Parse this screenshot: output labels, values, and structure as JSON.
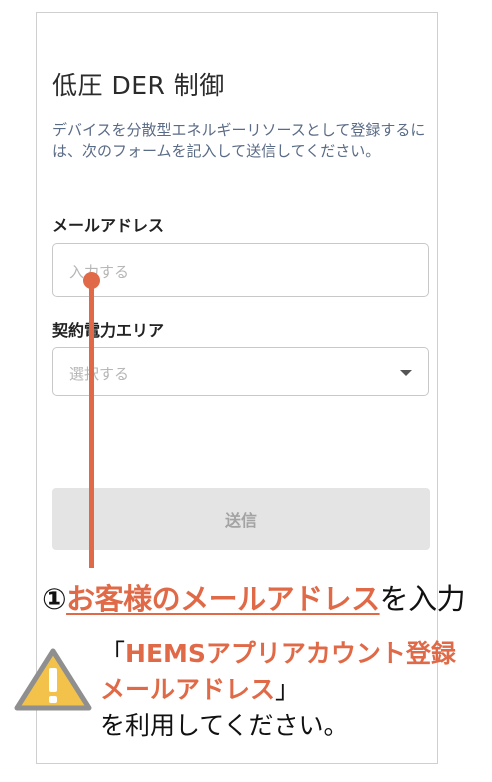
{
  "form": {
    "title": "低圧 DER 制御",
    "description": "デバイスを分散型エネルギーリソースとして登録するには、次のフォームを記入して送信してください。",
    "email_label": "メールアドレス",
    "email_placeholder": "入力する",
    "area_label": "契約電力エリア",
    "area_placeholder": "選択する",
    "submit_label": "送信"
  },
  "annotation": {
    "step_number": "①",
    "step_highlight": "お客様のメールアドレス",
    "step_suffix": "を入力",
    "note_open": "「",
    "note_highlight_1": "HEMSアプリアカウント登録",
    "note_highlight_2": "メールアドレス",
    "note_close": "」",
    "note_line3": "を利用してください。",
    "accent_color": "#e06a47",
    "warning_icon": "warning-triangle-icon"
  }
}
